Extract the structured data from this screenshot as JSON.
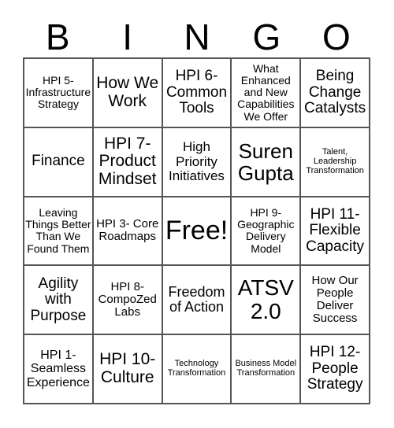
{
  "header": [
    "B",
    "I",
    "N",
    "G",
    "O"
  ],
  "cells": [
    "HPI 5- Infrastructure Strategy",
    "How We Work",
    "HPI 6- Common Tools",
    "What Enhanced and New Capabilities We Offer",
    "Being Change Catalysts",
    "Finance",
    "HPI 7- Product Mindset",
    "High Priority Initiatives",
    "Suren Gupta",
    "Talent, Leadership Transformation",
    "Leaving Things Better Than We Found Them",
    "HPI 3- Core Roadmaps",
    "Free!",
    "HPI 9- Geographic Delivery Model",
    "HPI 11- Flexible Capacity",
    "Agility with Purpose",
    "HPI 8- CompoZed Labs",
    "Freedom of Action",
    "ATSV 2.0",
    "How Our People Deliver Success",
    "HPI 1- Seamless Experience",
    "HPI 10- Culture",
    "Technology Transformation",
    "Business Model Transformation",
    "HPI 12- People Strategy"
  ]
}
